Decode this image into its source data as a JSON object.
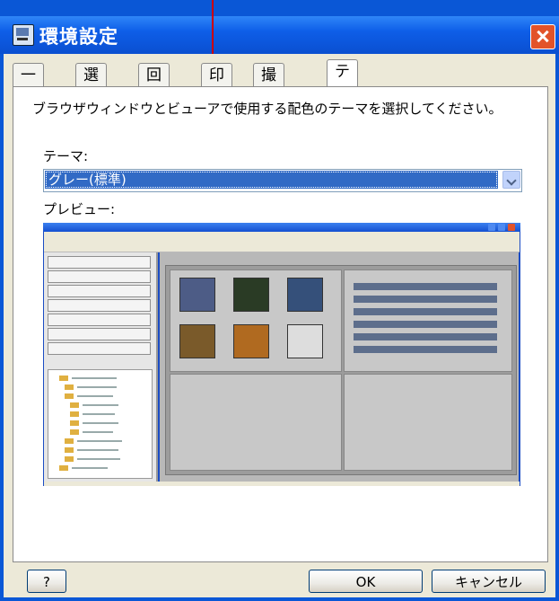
{
  "window": {
    "title": "環境設定"
  },
  "tabs": [
    {
      "label": "一般"
    },
    {
      "label": "選択"
    },
    {
      "label": "回転"
    },
    {
      "label": "印刷"
    },
    {
      "label": "撮影情報"
    },
    {
      "label": "テーマ"
    }
  ],
  "theme": {
    "description": "ブラウザウィンドウとビューアで使用する配色のテーマを選択してください。",
    "theme_label": "テーマ:",
    "selected_theme": "グレー(標準)",
    "preview_label": "プレビュー:"
  },
  "buttons": {
    "help": "?",
    "ok": "OK",
    "cancel": "キャンセル"
  },
  "colors": {
    "titlebar": "#0e5ee8",
    "selection": "#316ac5",
    "close": "#e2532a"
  }
}
